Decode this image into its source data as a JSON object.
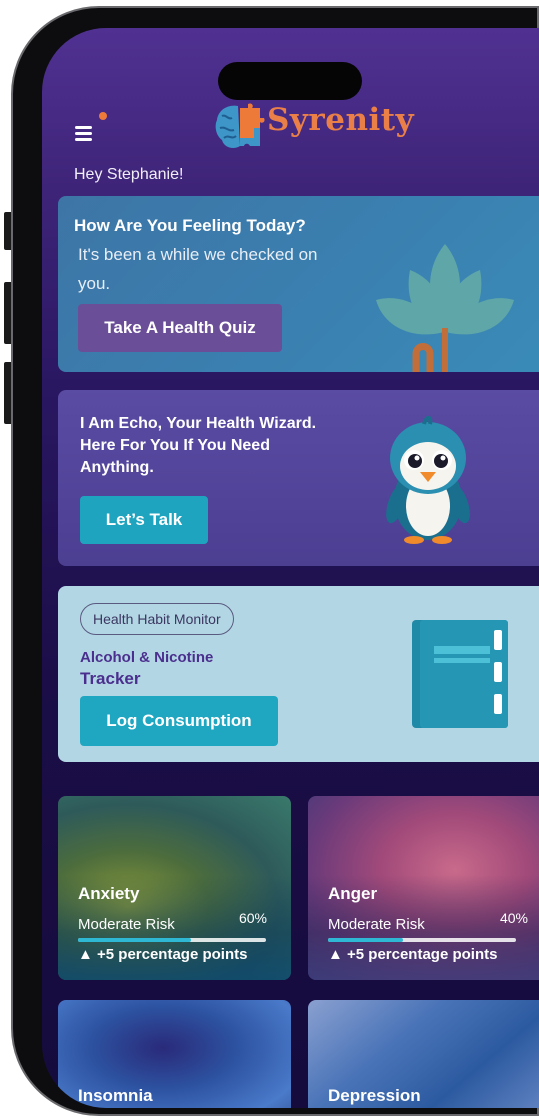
{
  "app": {
    "brand": "Syrenity",
    "greeting": "Hey Stephanie!"
  },
  "quiz_card": {
    "title": "How Are You Feeling Today?",
    "subtitle": "It's been a while we checked on you.",
    "button": "Take A Health Quiz"
  },
  "echo_card": {
    "message": "I Am Echo, Your Health Wizard. Here For You If You Need Anything.",
    "button": "Let’s Talk"
  },
  "tracker_card": {
    "badge": "Health Habit Monitor",
    "title_line1": "Alcohol & Nicotine",
    "title_line2": "Tracker",
    "button": "Log Consumption"
  },
  "conditions": [
    {
      "name": "Anxiety",
      "risk": "Moderate Risk",
      "percent": "60%",
      "level": 0.6,
      "change": "▲ +5 percentage points"
    },
    {
      "name": "Anger",
      "risk": "Moderate Risk",
      "percent": "40%",
      "level": 0.4,
      "change": "▲ +5 percentage points"
    },
    {
      "name": "Insomnia"
    },
    {
      "name": "Depression"
    }
  ],
  "colors": {
    "brand_orange": "#ea8048",
    "accent_cyan": "#1fa6c0",
    "background_purple": "#2a1762",
    "quiz_button": "#6a4e98"
  },
  "icons": [
    "menu-icon",
    "notification-dot",
    "brain-puzzle-logo",
    "lotus-icon",
    "penguin-mascot",
    "notebook-icon"
  ]
}
